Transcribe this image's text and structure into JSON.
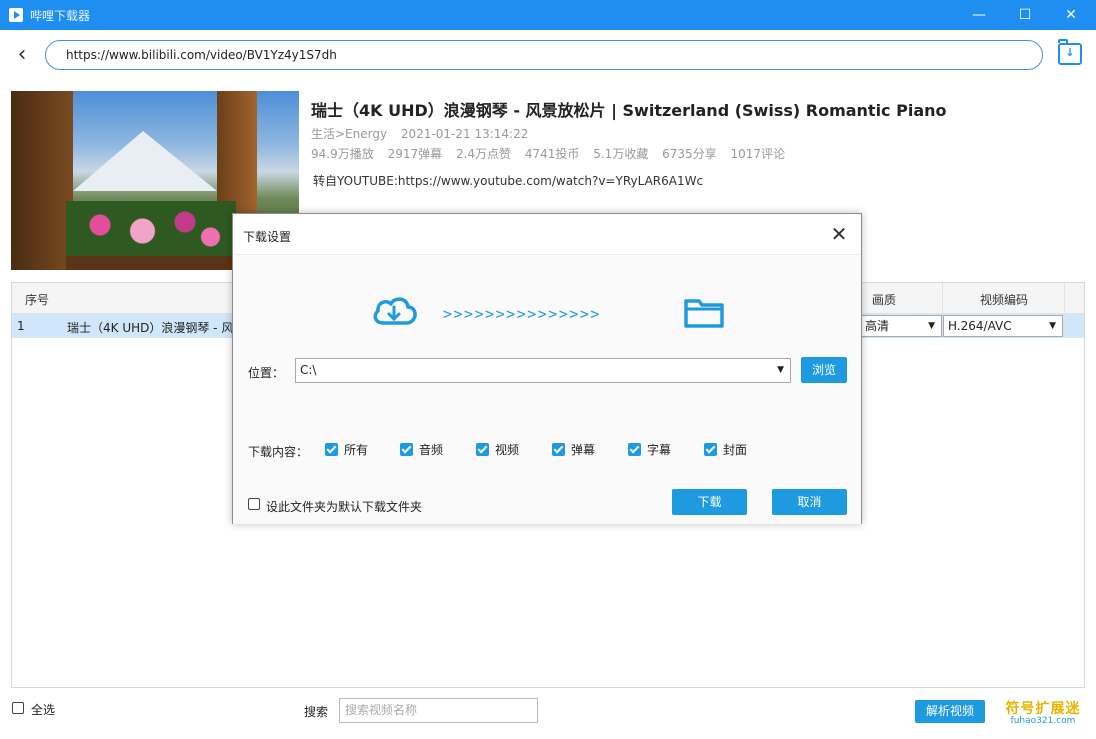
{
  "window": {
    "title": "哔哩下载器",
    "minimize_icon": "—",
    "maximize_icon": "☐",
    "close_icon": "✕"
  },
  "address": {
    "back_icon": "‹",
    "url": "https://www.bilibili.com/video/BV1Yz4y1S7dh",
    "download_folder_icon": "↓"
  },
  "video": {
    "title": "瑞士（4K UHD）浪漫钢琴 - 风景放松片 | Switzerland (Swiss) Romantic Piano",
    "category": "生活>Energy",
    "date": "2021-01-21 13:14:22",
    "stats": {
      "plays": "94.9万播放",
      "danmaku": "2917弹幕",
      "likes": "2.4万点赞",
      "coins": "4741投币",
      "favorites": "5.1万收藏",
      "shares": "6735分享",
      "comments": "1017评论"
    },
    "description": "转自YOUTUBE:https://www.youtube.com/watch?v=YRyLAR6A1Wc"
  },
  "table": {
    "headers": {
      "seq": "序号",
      "quality": "画质",
      "codec": "视频编码"
    },
    "rows": [
      {
        "seq": "1",
        "title": "瑞士（4K UHD）浪漫钢琴 - 风",
        "quality": "高清",
        "codec": "H.264/AVC"
      }
    ]
  },
  "footer": {
    "select_all": "全选",
    "search_label": "搜索",
    "search_placeholder": "搜索视频名称",
    "parse_button": "解析视频",
    "watermark_line1": "符号扩展迷",
    "watermark_line2": "fuhao321.com"
  },
  "dialog": {
    "title": "下载设置",
    "close_icon": "✕",
    "arrows": ">>>>>>>>>>>>>>>",
    "location_label": "位置：",
    "location_value": "C:\\",
    "browse_button": "浏览",
    "content_label": "下载内容：",
    "options": {
      "all": "所有",
      "audio": "音频",
      "video": "视频",
      "danmaku": "弹幕",
      "subtitle": "字幕",
      "cover": "封面"
    },
    "default_folder_label": "设此文件夹为默认下载文件夹",
    "download_button": "下载",
    "cancel_button": "取消"
  },
  "colors": {
    "accent": "#1e9be0",
    "titlebar": "#1e8ff0",
    "selected_row": "#cfe6fb"
  }
}
